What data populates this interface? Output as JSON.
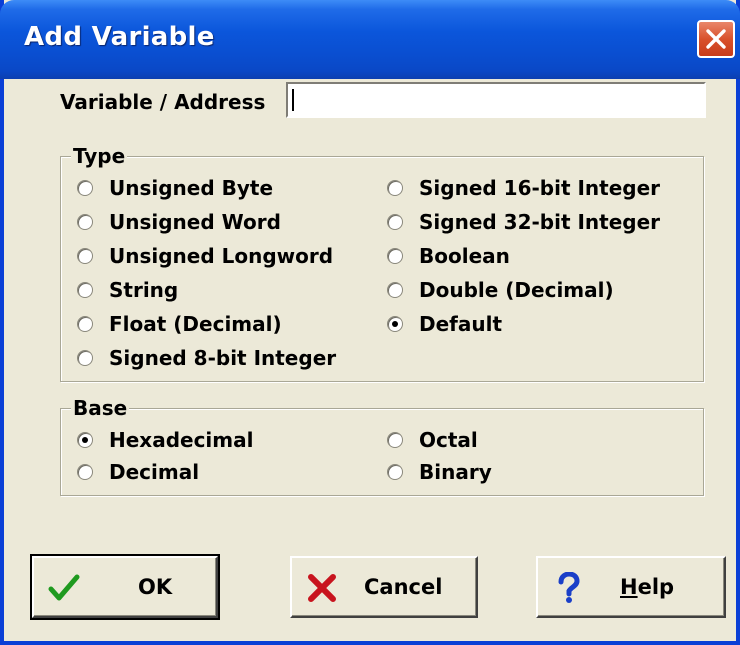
{
  "window": {
    "title": "Add Variable"
  },
  "address": {
    "label": "Variable / Address",
    "value": ""
  },
  "type_group": {
    "title": "Type",
    "options_left": [
      {
        "label": "Unsigned Byte",
        "checked": false
      },
      {
        "label": "Unsigned Word",
        "checked": false
      },
      {
        "label": "Unsigned Longword",
        "checked": false
      },
      {
        "label": "String",
        "checked": false
      },
      {
        "label": "Float (Decimal)",
        "checked": false
      },
      {
        "label": "Signed 8-bit Integer",
        "checked": false
      }
    ],
    "options_right": [
      {
        "label": "Signed 16-bit Integer",
        "checked": false
      },
      {
        "label": "Signed 32-bit Integer",
        "checked": false
      },
      {
        "label": "Boolean",
        "checked": false
      },
      {
        "label": "Double (Decimal)",
        "checked": false
      },
      {
        "label": "Default",
        "checked": true
      }
    ]
  },
  "base_group": {
    "title": "Base",
    "options_left": [
      {
        "label": "Hexadecimal",
        "checked": true
      },
      {
        "label": "Decimal",
        "checked": false
      }
    ],
    "options_right": [
      {
        "label": "Octal",
        "checked": false
      },
      {
        "label": "Binary",
        "checked": false
      }
    ]
  },
  "buttons": {
    "ok": {
      "label": "OK",
      "icon": "checkmark-icon"
    },
    "cancel": {
      "label": "Cancel",
      "icon": "x-icon"
    },
    "help": {
      "label_mnemonic": "H",
      "label_rest": "elp",
      "icon": "question-mark-icon"
    }
  },
  "colors": {
    "titlebar": "#0a4ed0",
    "dialog_bg": "#ece9d8",
    "ok_icon": "#1f9a1f",
    "cancel_icon": "#c8141e",
    "help_icon": "#1a3fc8"
  }
}
